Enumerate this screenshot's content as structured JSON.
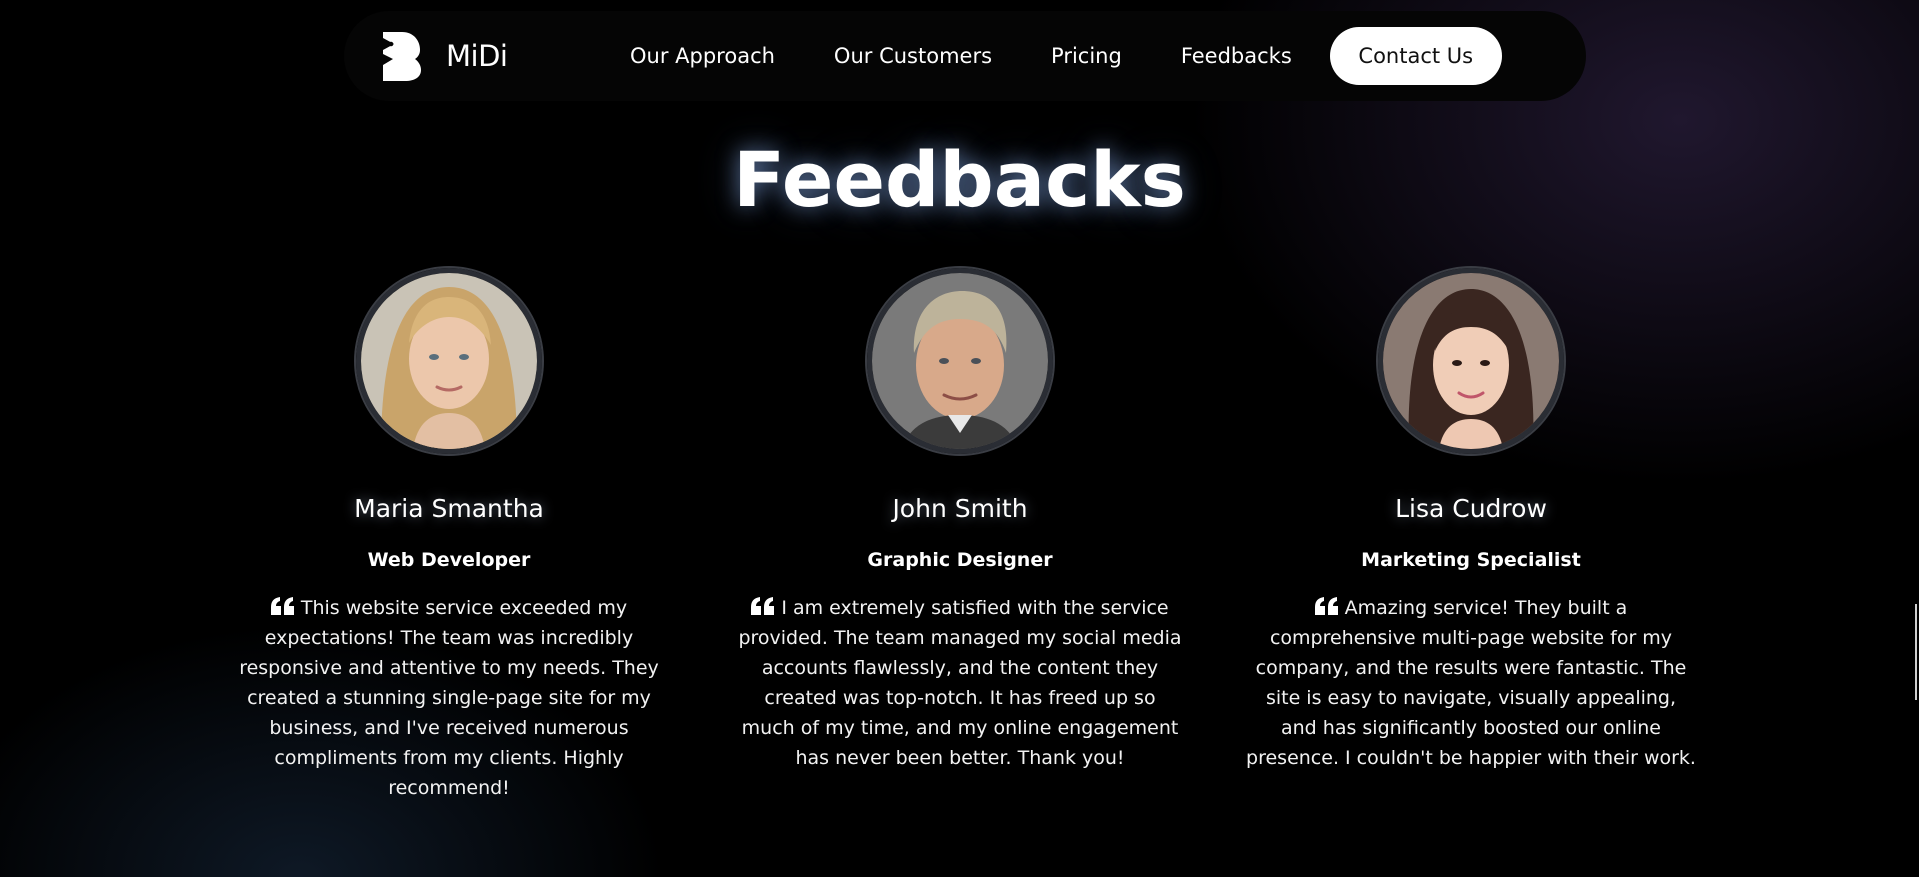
{
  "brand": {
    "name": "MiDi",
    "logo_icon": "midi-logo-icon"
  },
  "nav": {
    "links": [
      "Our Approach",
      "Our Customers",
      "Pricing",
      "Feedbacks"
    ],
    "contact_label": "Contact Us"
  },
  "section": {
    "title": "Feedbacks"
  },
  "testimonials": [
    {
      "name": "Maria Smantha",
      "role": "Web Developer",
      "quote": "This website service exceeded my expectations! The team was incredibly responsive and attentive to my needs. They created a stunning single-page site for my business, and I've received numerous compliments from my clients. Highly recommend!",
      "avatar_icon": "avatar-photo-icon"
    },
    {
      "name": "John Smith",
      "role": "Graphic Designer",
      "quote": "I am extremely satisfied with the service provided. The team managed my social media accounts flawlessly, and the content they created was top-notch. It has freed up so much of my time, and my online engagement has never been better. Thank you!",
      "avatar_icon": "avatar-photo-icon"
    },
    {
      "name": "Lisa Cudrow",
      "role": "Marketing Specialist",
      "quote": "Amazing service! They built a comprehensive multi-page website for my company, and the results were fantastic. The site is easy to navigate, visually appealing, and has significantly boosted our online presence. I couldn't be happier with their work.",
      "avatar_icon": "avatar-photo-icon"
    }
  ],
  "colors": {
    "background": "#000000",
    "nav_background": "#050505",
    "button_background": "#ffffff",
    "button_text": "#111111",
    "text": "#ffffff",
    "avatar_ring": "#2a2d34"
  }
}
